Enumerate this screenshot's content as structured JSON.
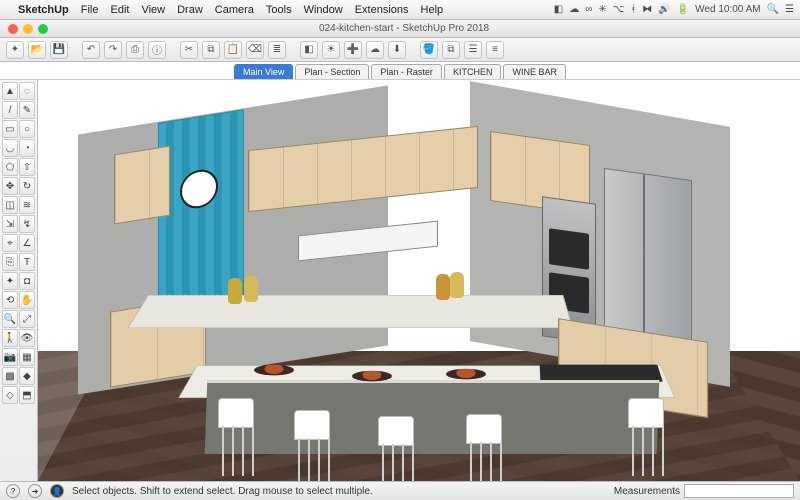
{
  "mac": {
    "app_name": "SketchUp",
    "menus": [
      "File",
      "Edit",
      "View",
      "Draw",
      "Camera",
      "Tools",
      "Window",
      "Extensions",
      "Help"
    ],
    "clock": "Wed 10:00 AM",
    "status_icons": [
      "bt",
      "wifi",
      "vol",
      "batt",
      "search",
      "menu"
    ]
  },
  "window": {
    "title": "024-kitchen-start - SketchUp Pro 2018"
  },
  "toolbar": {
    "buttons": [
      "new",
      "open",
      "save",
      "undo",
      "redo",
      "print",
      "model-info",
      "cut",
      "copy",
      "paste",
      "erase",
      "layers",
      "styles",
      "shadows",
      "scene-add",
      "3d-warehouse",
      "ext-warehouse",
      "paint",
      "components",
      "outliner",
      "layout"
    ]
  },
  "scenes": {
    "tabs": [
      {
        "label": "Main View",
        "active": true
      },
      {
        "label": "Plan - Section",
        "active": false
      },
      {
        "label": "Plan - Raster",
        "active": false
      },
      {
        "label": "KITCHEN",
        "active": false
      },
      {
        "label": "WINE BAR",
        "active": false
      }
    ]
  },
  "palette": {
    "tools": [
      "select",
      "lasso",
      "eraser",
      "paint",
      "line",
      "freehand",
      "rectangle",
      "circle",
      "arc",
      "pie",
      "polygon",
      "pushpull",
      "move",
      "rotate",
      "scale",
      "offset",
      "followme",
      "tape",
      "protractor",
      "dimension",
      "text",
      "axes",
      "section",
      "orbit",
      "pan",
      "zoom",
      "zoom-extents",
      "walk",
      "look",
      "position-camera",
      "sandbox-a",
      "sandbox-b",
      "solid-a",
      "solid-b"
    ]
  },
  "statusbar": {
    "hint": "Select objects. Shift to extend select. Drag mouse to select multiple.",
    "meas_label": "Measurements"
  },
  "palette_glyphs": [
    "▲",
    "◌",
    "/",
    "✎",
    "▭",
    "○",
    "◡",
    "◔",
    "⬠",
    "⇧",
    "✥",
    "↻",
    "◫",
    "≋",
    "⇲",
    "↯",
    "⌖",
    "∠",
    "⎘",
    "T",
    "✦",
    "◘",
    "⟲",
    "✋",
    "🔍",
    "⤢",
    "🚶",
    "👁",
    "📷",
    "▦",
    "▩",
    "◆",
    "◇",
    "⬒"
  ],
  "toolbar_glyphs": [
    "✦",
    "📂",
    "💾",
    "↶",
    "↷",
    "⎙",
    "ⓘ",
    "✂",
    "⧉",
    "📋",
    "⌫",
    "≣",
    "◧",
    "☀",
    "➕",
    "☁",
    "⬇",
    "🪣",
    "⧉",
    "☰",
    "≡"
  ]
}
